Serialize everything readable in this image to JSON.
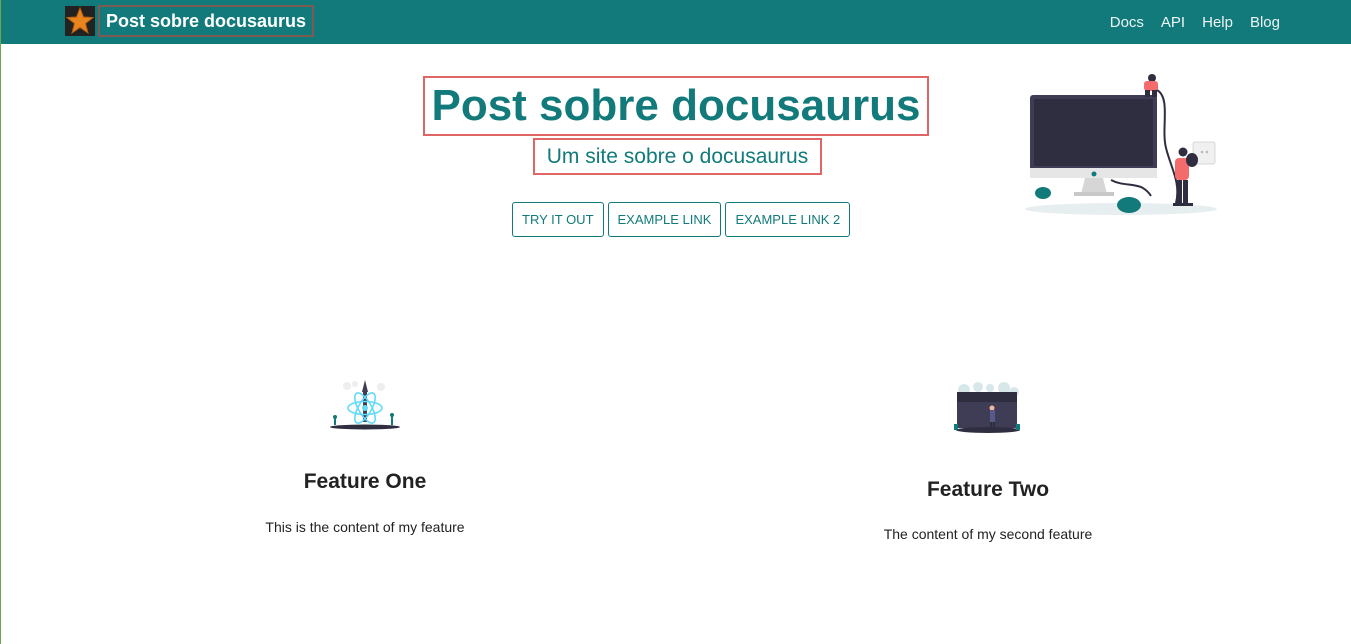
{
  "header": {
    "brand": "Post sobre docusaurus",
    "logo_icon": "star-icon",
    "nav": [
      {
        "label": "Docs"
      },
      {
        "label": "API"
      },
      {
        "label": "Help"
      },
      {
        "label": "Blog"
      }
    ],
    "background_color": "#127a7a"
  },
  "hero": {
    "title": "Post sobre docusaurus",
    "subtitle": "Um site sobre o docusaurus",
    "buttons": [
      {
        "label": "TRY IT OUT"
      },
      {
        "label": "EXAMPLE LINK"
      },
      {
        "label": "EXAMPLE LINK 2"
      }
    ],
    "illustration": "computer-with-people-illustration"
  },
  "features": [
    {
      "title": "Feature One",
      "text": "This is the content of my feature",
      "image": "react-atom-illustration"
    },
    {
      "title": "Feature Two",
      "text": "The content of my second feature",
      "image": "server-illustration"
    }
  ],
  "colors": {
    "primary": "#127a7a",
    "highlight_border": "#e06666",
    "text_dark": "#222222"
  }
}
